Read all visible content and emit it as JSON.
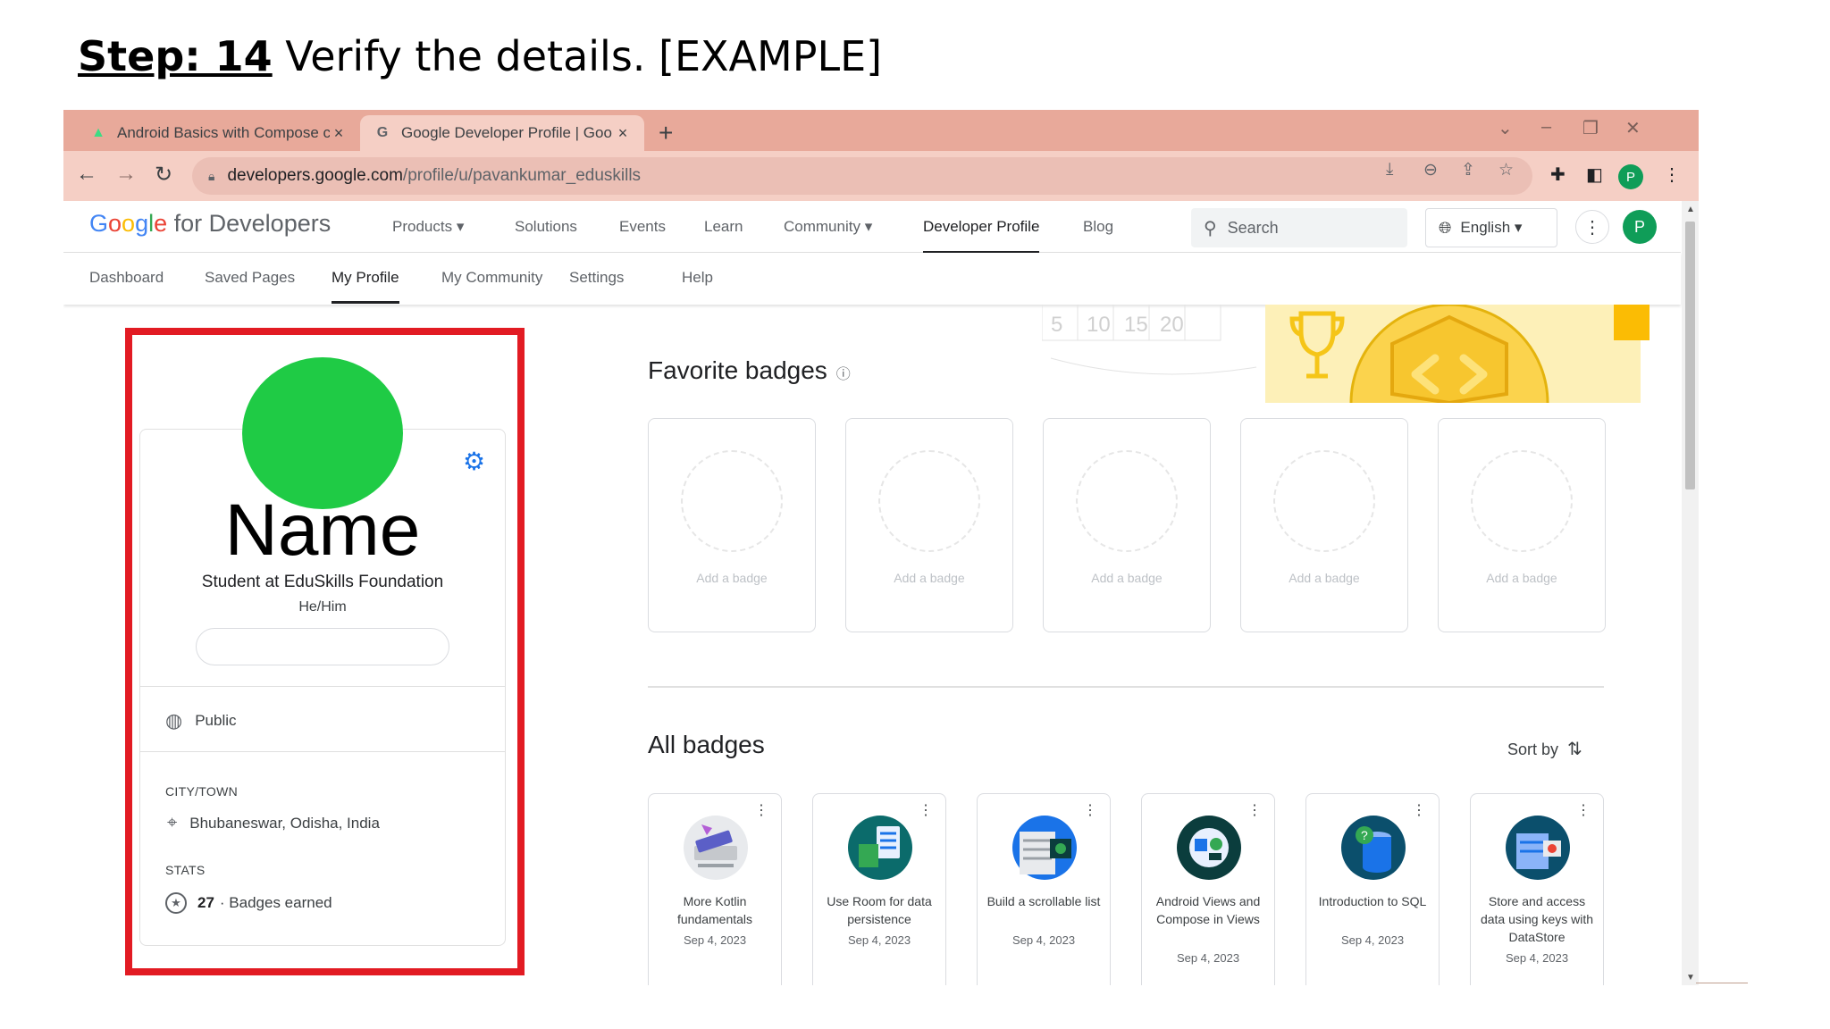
{
  "slide": {
    "step_label": "Step: 14",
    "step_text": " Verify the details. [EXAMPLE]"
  },
  "browser": {
    "tabs": [
      {
        "title": "Android Basics with Compose co",
        "icon": "android-icon",
        "active": false
      },
      {
        "title": "Google Developer Profile  |  Goo",
        "icon": "google-g-icon",
        "active": true
      }
    ],
    "url_host": "developers.google.com",
    "url_path": "/profile/u/pavankumar_eduskills",
    "profile_initial": "P"
  },
  "site": {
    "logo": {
      "g": "G",
      "o1": "o",
      "o2": "o",
      "g2": "g",
      "l": "l",
      "e": "e",
      "suffix": " for Developers"
    },
    "nav": [
      {
        "label": "Products",
        "has_dropdown": true
      },
      {
        "label": "Solutions"
      },
      {
        "label": "Events"
      },
      {
        "label": "Learn"
      },
      {
        "label": "Community",
        "has_dropdown": true
      },
      {
        "label": "Developer Profile",
        "active": true
      },
      {
        "label": "Blog"
      }
    ],
    "search_placeholder": "Search",
    "language": "English",
    "avatar_initial": "P",
    "subnav": [
      {
        "label": "Dashboard"
      },
      {
        "label": "Saved Pages"
      },
      {
        "label": "My Profile",
        "active": true
      },
      {
        "label": "My Community"
      },
      {
        "label": "Settings"
      },
      {
        "label": "Help"
      }
    ]
  },
  "profile": {
    "name": "Name",
    "role": "Student at EduSkills Foundation",
    "pronouns": "He/Him",
    "visibility": "Public",
    "city_label": "CITY/TOWN",
    "city": "Bhubaneswar, Odisha, India",
    "stats_label": "STATS",
    "badges_count": "27",
    "badges_text": "· Badges earned",
    "avatar_color": "#1fcb45",
    "highlight_color": "#e21b23"
  },
  "hero_ticks": [
    "5",
    "10",
    "15",
    "20"
  ],
  "favorites": {
    "title": "Favorite badges",
    "slots": [
      "Add a badge",
      "Add a badge",
      "Add a badge",
      "Add a badge",
      "Add a badge"
    ]
  },
  "all_badges": {
    "title": "All badges",
    "sort_label": "Sort by",
    "items": [
      {
        "title": "More Kotlin fundamentals",
        "date": "Sep 4, 2023",
        "icon": "kotlin-badge-icon"
      },
      {
        "title": "Use Room for data persistence",
        "date": "Sep 4, 2023",
        "icon": "room-badge-icon"
      },
      {
        "title": "Build a scrollable list",
        "date": "Sep 4, 2023",
        "icon": "scrollable-list-badge-icon"
      },
      {
        "title": "Android Views and Compose in Views",
        "date": "Sep 4, 2023",
        "icon": "views-compose-badge-icon"
      },
      {
        "title": "Introduction to SQL",
        "date": "Sep 4, 2023",
        "icon": "sql-badge-icon"
      },
      {
        "title": "Store and access data using keys with DataStore",
        "date": "Sep 4, 2023",
        "icon": "datastore-badge-icon"
      }
    ]
  }
}
